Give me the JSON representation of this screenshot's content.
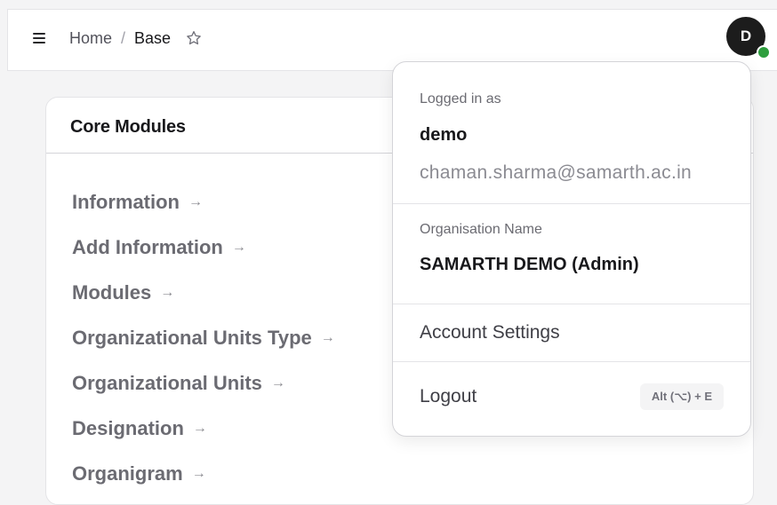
{
  "header": {
    "breadcrumb": {
      "home": "Home",
      "separator": "/",
      "current": "Base"
    },
    "avatar_initial": "D",
    "status_color": "#2e9e3e"
  },
  "card": {
    "title": "Core Modules",
    "arrow_glyph": "→",
    "modules": [
      {
        "label": "Information"
      },
      {
        "label": "Add Information"
      },
      {
        "label": "Modules"
      },
      {
        "label": "Organizational Units Type"
      },
      {
        "label": "Organizational Units"
      },
      {
        "label": "Designation"
      },
      {
        "label": "Organigram"
      }
    ]
  },
  "user_menu": {
    "logged_in_label": "Logged in as",
    "username": "demo",
    "email": "chaman.sharma@samarth.ac.in",
    "org_label": "Organisation Name",
    "org_name": "SAMARTH DEMO (Admin)",
    "account_settings": "Account Settings",
    "logout": "Logout",
    "logout_shortcut": "Alt (⌥) + E"
  }
}
